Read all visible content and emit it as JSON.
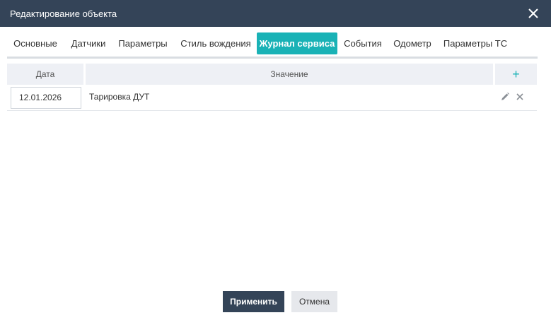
{
  "dialog": {
    "title": "Редактирование объекта",
    "close_icon": "close-icon"
  },
  "tabs": [
    {
      "label": "Основные",
      "active": false
    },
    {
      "label": "Датчики",
      "active": false
    },
    {
      "label": "Параметры",
      "active": false
    },
    {
      "label": "Стиль вождения",
      "active": false
    },
    {
      "label": "Журнал сервиса",
      "active": true
    },
    {
      "label": "События",
      "active": false
    },
    {
      "label": "Одометр",
      "active": false
    },
    {
      "label": "Параметры ТС",
      "active": false
    }
  ],
  "table": {
    "headers": {
      "date": "Дата",
      "value": "Значение",
      "add": "+"
    },
    "rows": [
      {
        "date": "12.01.2026",
        "value": "Тарировка ДУТ"
      }
    ]
  },
  "buttons": {
    "apply": "Применить",
    "cancel": "Отмена"
  },
  "colors": {
    "titlebar": "#344458",
    "accent": "#19b2b6",
    "header_bg": "#eef0f5"
  }
}
